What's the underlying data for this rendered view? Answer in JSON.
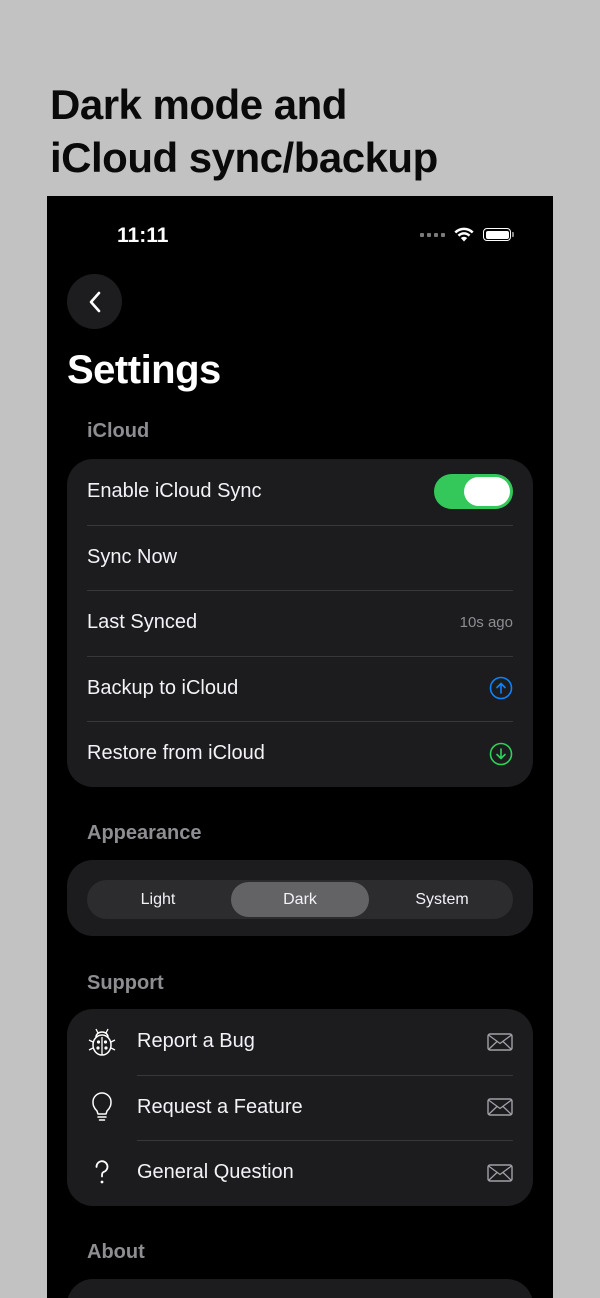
{
  "headline": {
    "line1": "Dark mode and",
    "line2": "iCloud sync/backup"
  },
  "status_bar": {
    "time": "11:11"
  },
  "nav": {
    "back_icon": "chevron-left-icon",
    "title": "Settings"
  },
  "icloud": {
    "header": "iCloud",
    "enable_sync_label": "Enable iCloud Sync",
    "enable_sync_on": true,
    "sync_now_label": "Sync Now",
    "last_synced_label": "Last Synced",
    "last_synced_value": "10s ago",
    "backup_label": "Backup to iCloud",
    "backup_icon": "arrow-up-circle-icon",
    "restore_label": "Restore from iCloud",
    "restore_icon": "arrow-down-circle-icon"
  },
  "appearance": {
    "header": "Appearance",
    "options": [
      "Light",
      "Dark",
      "System"
    ],
    "selected": "Dark"
  },
  "support": {
    "header": "Support",
    "items": [
      {
        "label": "Report a Bug",
        "icon": "ladybug-icon",
        "action_icon": "envelope-icon"
      },
      {
        "label": "Request a Feature",
        "icon": "lightbulb-icon",
        "action_icon": "envelope-icon"
      },
      {
        "label": "General Question",
        "icon": "question-mark-icon",
        "action_icon": "envelope-icon"
      }
    ]
  },
  "about": {
    "header": "About"
  },
  "colors": {
    "toggle_on": "#34c759",
    "backup_icon": "#0a84ff",
    "restore_icon": "#30d158",
    "background": "#000000",
    "card": "#1c1c1e"
  }
}
